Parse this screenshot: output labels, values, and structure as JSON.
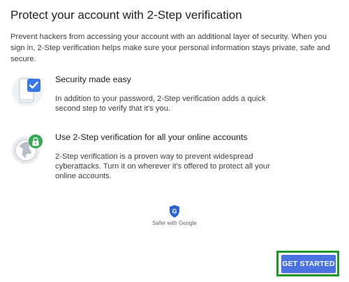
{
  "header": {
    "title": "Protect your account with 2-Step verification"
  },
  "intro": "Prevent hackers from accessing your account with an additional layer of security. When you sign in, 2-Step verification helps make sure your personal information stays private, safe and secure.",
  "features": [
    {
      "icon": "phone-check-icon",
      "heading": "Security made easy",
      "description": "In addition to your password, 2-Step verification adds a quick second step to verify that it's you."
    },
    {
      "icon": "globe-lock-icon",
      "heading": "Use 2-Step verification for all your online accounts",
      "description": "2-Step verification is a proven way to prevent widespread cyberattacks. Turn it on wherever it's offered to protect all your online accounts."
    }
  ],
  "footer": {
    "safer_prefix": "Safer with ",
    "safer_brand": "Google",
    "shield_letter": "G"
  },
  "actions": {
    "get_started_label": "GET STARTED"
  },
  "colors": {
    "accent": "#4a72e0",
    "highlight": "#1e9a2a",
    "check_blue": "#3b78e7",
    "lock_green": "#34a853",
    "shield_blue": "#2d64d4"
  }
}
